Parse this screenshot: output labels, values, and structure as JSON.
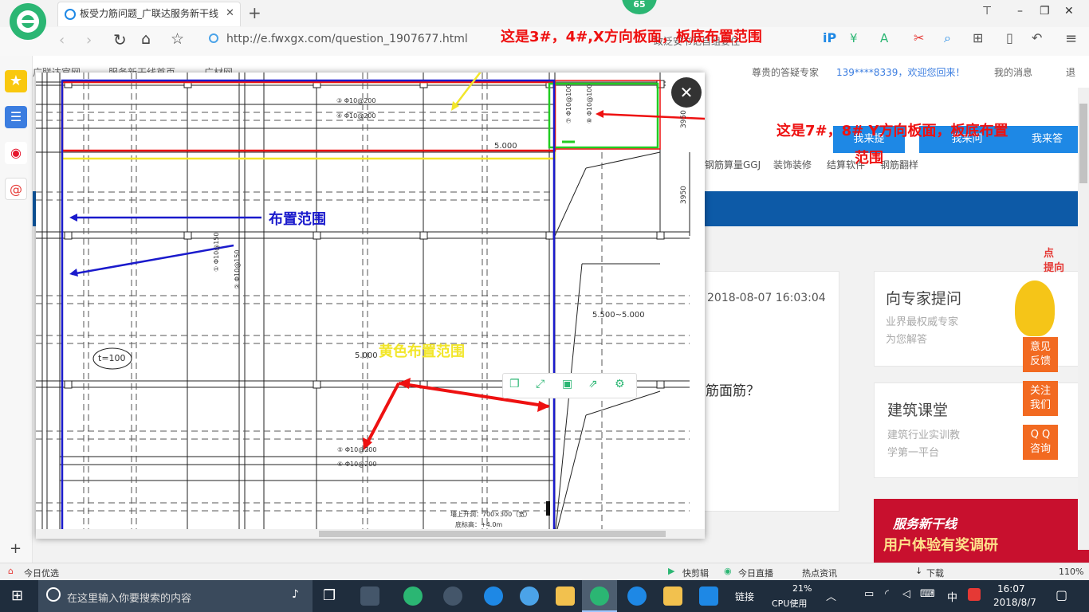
{
  "browser": {
    "tab_title": "板受力筋问题_广联达服务新干线",
    "new_tab": "+",
    "badge": "65",
    "url": "http://e.fwxgx.com/question_1907677.html",
    "search_hint": "政泛安书记自组要住",
    "window_controls": [
      "⊤",
      "–",
      "❐",
      "✕"
    ]
  },
  "site": {
    "nav_left": [
      "广联达官网",
      "服务新干线首页",
      "广材网"
    ],
    "expert": "尊贵的答疑专家",
    "user": "139****8339，欢迎您回来！",
    "messages": "我的消息",
    "logout": "退",
    "subnav": [
      "钢筋算量GGJ",
      "装饰装修",
      "结算软件",
      "钢筋翻样"
    ],
    "btn_ask": "我来提",
    "btn_ask2": "我来问",
    "btn_answer": "我来答",
    "date": "2018-08-07 16:03:04",
    "question": "筋面筋？",
    "card1_title": "向专家提问",
    "card1_sub1": "业界最权威专家",
    "card1_sub2": "为您解答",
    "card2_title": "建筑课堂",
    "card2_sub1": "建筑行业实训教",
    "card2_sub2": "学第一平台",
    "promo": "服务新干线",
    "promo2": "用户体验有奖调研",
    "floating": [
      "意见\n反馈",
      "关注\n我们",
      "Q Q\n咨询"
    ],
    "side_promo": "点\n提向"
  },
  "drawing": {
    "labels": {
      "r3": "③ Φ10@200",
      "r4": "④ Φ10@200",
      "r5": "⑤ Φ10@200",
      "r6": "⑥ Φ10@200",
      "c1": "① Φ10@150",
      "c2": "② Φ10@150",
      "c7": "⑦ Φ10@100",
      "c8": "⑧ Φ10@100",
      "elev1": "5.000",
      "elev2": "5.000",
      "elev3": "5.500~5.000",
      "thickness": "t=100",
      "dim1": "3950",
      "dim2": "3950",
      "hole1": "墙上开洞：700×300（宽）",
      "hole2": "底标高：+4.0m"
    },
    "annotations": {
      "red_top": "这是3#，4#,X方向板面，板底布置范围",
      "red_right1": "这是7#，8# Y方向板面，板底布置",
      "red_right2": "范围",
      "blue": "布置范围",
      "yellow": "黄色布置范围"
    },
    "toolbar_icons": [
      "copy-icon",
      "expand-icon",
      "save-icon",
      "share-icon",
      "settings-icon"
    ],
    "close": "✕",
    "colors": {
      "red": "#ee1111",
      "blue": "#1a1acc",
      "yellow": "#f2e62a",
      "green": "#22cc22"
    }
  },
  "statusbar": {
    "left": "今日优选",
    "items": [
      "快剪辑",
      "今日直播",
      "热点资讯",
      "下载"
    ],
    "zoom": "110%"
  },
  "taskbar": {
    "search": "在这里输入你要搜索的内容",
    "links": "链接",
    "cpu_pct": "21%",
    "cpu_label": "CPU使用",
    "ime": "中",
    "time": "16:07",
    "date": "2018/8/7"
  }
}
